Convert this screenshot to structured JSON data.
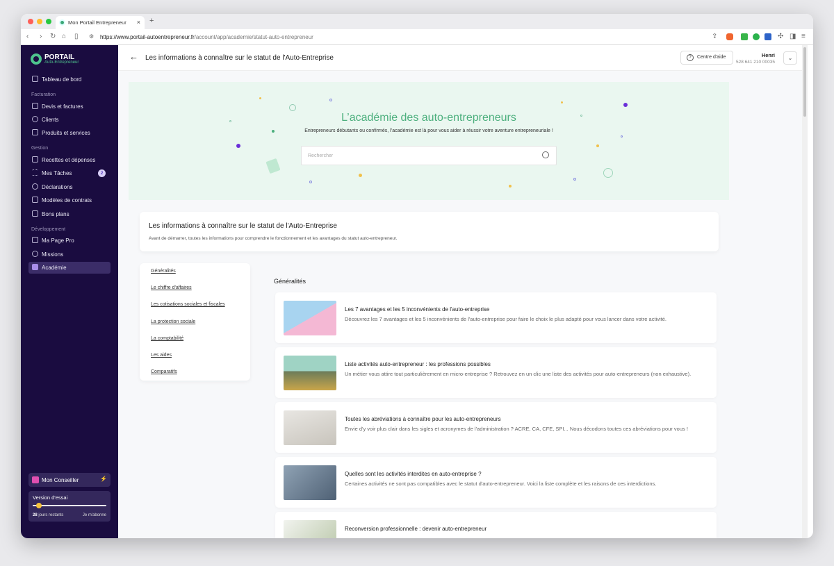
{
  "browser": {
    "tab_title": "Mon Portail Entrepreneur",
    "url_host": "https://www.portail-autoentrepreneur.fr",
    "url_path": "/account/app/academie/statut-auto-entrepreneur"
  },
  "logo": {
    "title": "PORTAIL",
    "subtitle": "Auto-Entrepreneur"
  },
  "sidebar": {
    "dashboard": "Tableau de bord",
    "sections": [
      "Facturation",
      "Gestion",
      "Développement"
    ],
    "items": [
      {
        "label": "Devis et factures",
        "icon": "document-icon"
      },
      {
        "label": "Clients",
        "icon": "users-icon"
      },
      {
        "label": "Produits et services",
        "icon": "folder-icon"
      },
      {
        "label": "Recettes et dépenses",
        "icon": "wallet-icon"
      },
      {
        "label": "Mes Tâches",
        "icon": "list-icon",
        "badge": "2"
      },
      {
        "label": "Déclarations",
        "icon": "euro-icon"
      },
      {
        "label": "Modèles de contrats",
        "icon": "contract-icon"
      },
      {
        "label": "Bons plans",
        "icon": "ticket-icon"
      },
      {
        "label": "Ma Page Pro",
        "icon": "laptop-icon"
      },
      {
        "label": "Missions",
        "icon": "tag-icon"
      },
      {
        "label": "Académie",
        "icon": "book-icon",
        "active": true
      }
    ],
    "advisor": "Mon Conseiller",
    "trial": {
      "title": "Version d'essai",
      "days": "28",
      "days_label": "jours restants",
      "subscribe": "Je m'abonne",
      "progress": 0.05
    }
  },
  "header": {
    "title": "Les informations à connaître sur le statut de l'Auto-Entreprise",
    "help": "Centre d'aide",
    "user_name": "Henri",
    "siret": "528 641 210 00035"
  },
  "hero": {
    "title": "L’académie des auto-entrepreneurs",
    "subtitle": "Entrepreneurs débutants ou confirmés, l’académie est là pour vous aider à réussir votre aventure entrepreneuriale !",
    "search_placeholder": "Rechercher"
  },
  "intro": {
    "title": "Les informations à connaître sur le statut de l'Auto-Entreprise",
    "text": "Avant de démarrer, toutes les informations pour comprendre le fonctionnement et les avantages du statut auto-entrepreneur."
  },
  "toc": [
    "Généralités",
    "Le chiffre d'affaires",
    "Les cotisations sociales et fiscales",
    "La protection sociale",
    "La comptabilité",
    "Les aides",
    "Comparatifs"
  ],
  "section_title": "Généralités",
  "articles": [
    {
      "title": "Les 7 avantages et les 5 inconvénients de l'auto-entreprise",
      "desc": "Découvrez les 7 avantages et les 5 inconvénients de l'auto-entreprise pour faire le choix le plus adapté pour vous lancer dans votre activité."
    },
    {
      "title": "Liste activités auto-entrepreneur : les professions possibles",
      "desc": "Un métier vous attire tout particulièrement en micro-entreprise ? Retrouvez en un clic une liste des activités pour auto-entrepreneurs (non exhaustive)."
    },
    {
      "title": "Toutes les abréviations à connaître pour les auto-entrepreneurs",
      "desc": "Envie d'y voir plus clair dans les sigles et acronymes de l'administration ? ACRE, CA, CFE, SPI... Nous décodons toutes ces abréviations pour vous !"
    },
    {
      "title": "Quelles sont les activités interdites en auto-entreprise ?",
      "desc": "Certaines activités ne sont pas compatibles avec le statut d'auto-entrepreneur. Voici la liste complète et les raisons de ces interdictions."
    },
    {
      "title": "Reconversion professionnelle : devenir auto-entrepreneur",
      "desc": ""
    }
  ]
}
